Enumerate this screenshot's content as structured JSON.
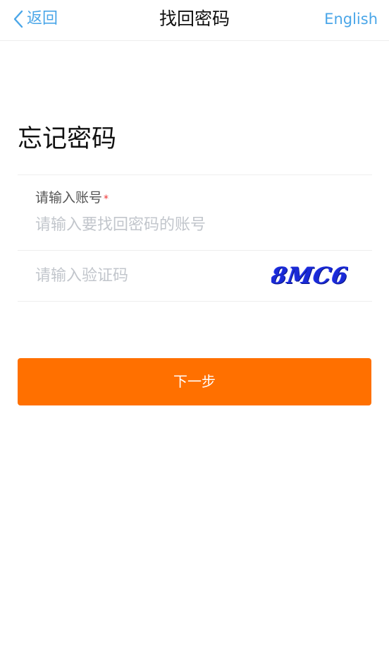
{
  "nav": {
    "back_label": "返回",
    "title": "找回密码",
    "language_label": "English",
    "link_color": "#4aa6e8"
  },
  "page": {
    "heading": "忘记密码"
  },
  "form": {
    "account": {
      "label": "请输入账号",
      "required_mark": "*",
      "value": "",
      "placeholder": "请输入要找回密码的账号"
    },
    "captcha": {
      "value": "",
      "placeholder": "请输入验证码",
      "image_text": "8MC6"
    },
    "next_button_label": "下一步",
    "next_button_color": "#ff7000"
  }
}
